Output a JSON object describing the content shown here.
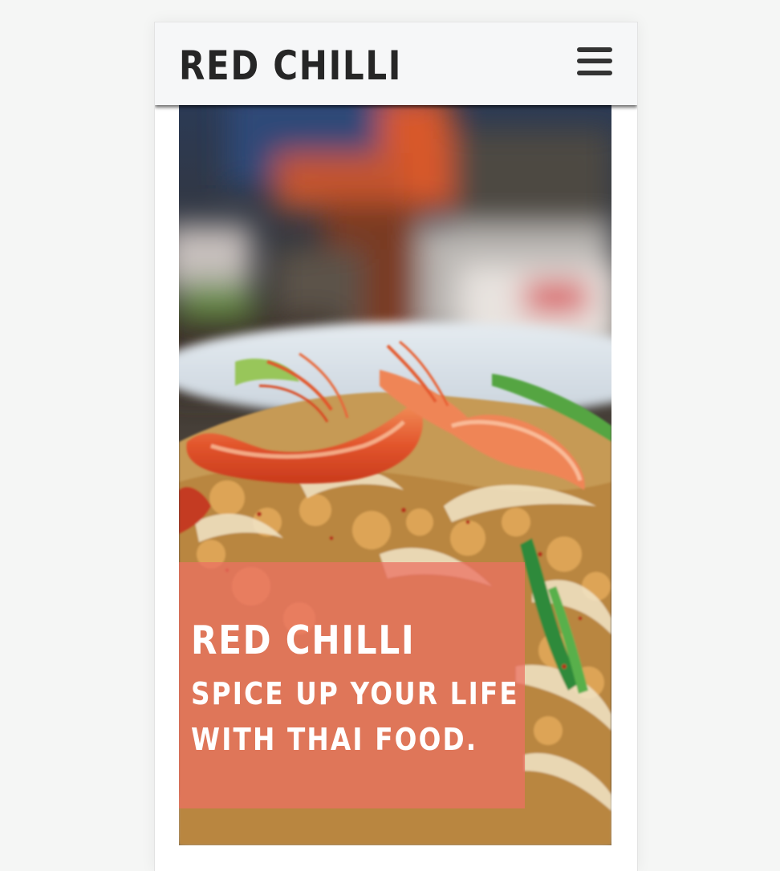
{
  "header": {
    "brand": "RED CHILLI",
    "menu_icon": "hamburger-menu-icon"
  },
  "hero": {
    "image_subject": "shrimp-pad-thai-photo",
    "title": "RED CHILLI",
    "tagline": "SPICE UP YOUR LIFE WITH THAI FOOD.",
    "overlay_color": "#ec7062"
  },
  "colors": {
    "page_background": "#f5f6f5",
    "header_background": "#f6f7f8",
    "brand_text": "#262626",
    "menu_icon": "#333333"
  }
}
